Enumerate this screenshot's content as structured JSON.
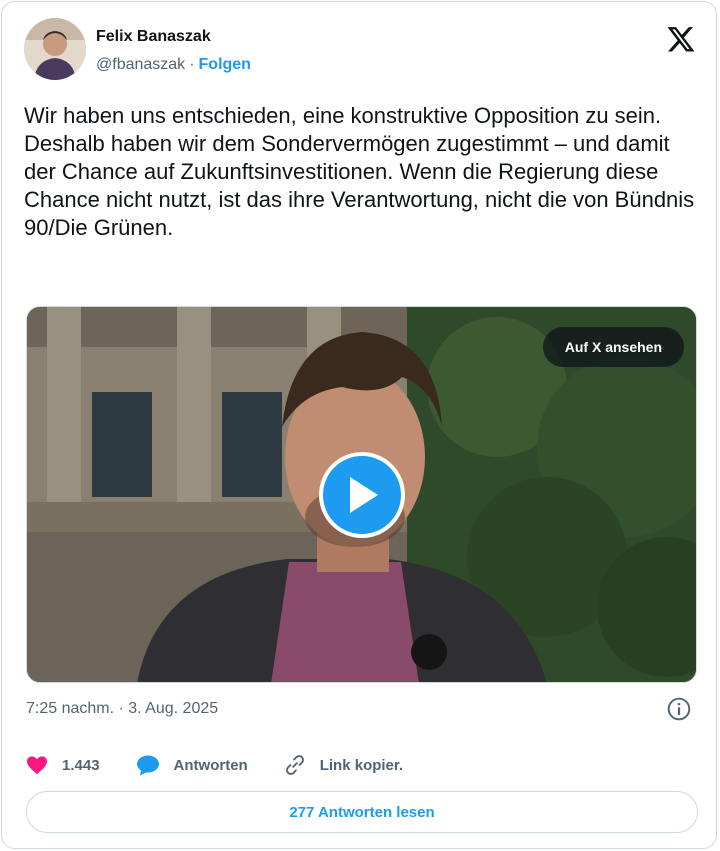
{
  "author": {
    "name": "Felix Banaszak",
    "handle": "@fbanaszak",
    "separator": "·",
    "follow_label": "Folgen"
  },
  "tweet": {
    "text": "Wir haben uns entschieden, eine konstruktive Opposition zu sein. Deshalb haben wir dem Sondervermögen zugestimmt – und damit der Chance auf Zukunftsinvestitionen. Wenn die Regierung diese Chance nicht nutzt, ist das ihre Verantwortung, nicht die von Bündnis 90/Die Grünen.",
    "timestamp": "7:25 nachm. · 3. Aug. 2025"
  },
  "media": {
    "view_on_x_label": "Auf X ansehen",
    "type": "video"
  },
  "actions": {
    "like_count": "1.443",
    "reply_label": "Antworten",
    "copy_link_label": "Link kopier."
  },
  "read_replies_label": "277 Antworten lesen",
  "colors": {
    "accent": "#1d9bf0",
    "like": "#f91880",
    "text": "#0f1419",
    "secondary": "#536471",
    "border": "#cfd9de"
  },
  "icons": [
    "x-logo-icon",
    "play-icon",
    "info-icon",
    "heart-icon",
    "reply-icon",
    "link-icon"
  ]
}
